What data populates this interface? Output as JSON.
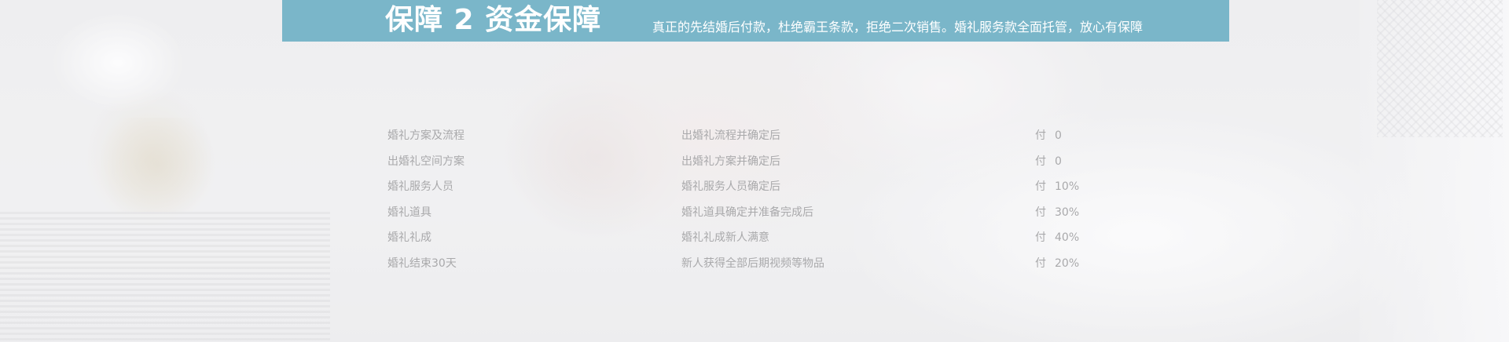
{
  "banner": {
    "title": "保障 2 资金保障",
    "description": "真正的先结婚后付款，杜绝霸王条款，拒绝二次销售。婚礼服务款全面托管，放心有保障",
    "color": "#7ab6c9"
  },
  "table": {
    "rows": [
      {
        "item": "婚礼方案及流程",
        "condition": "出婚礼流程并确定后",
        "pay_label": "付",
        "amount": "0"
      },
      {
        "item": "出婚礼空间方案",
        "condition": "出婚礼方案并确定后",
        "pay_label": "付",
        "amount": "0"
      },
      {
        "item": "婚礼服务人员",
        "condition": "婚礼服务人员确定后",
        "pay_label": "付",
        "amount": "10%"
      },
      {
        "item": "婚礼道具",
        "condition": "婚礼道具确定并准备完成后",
        "pay_label": "付",
        "amount": "30%"
      },
      {
        "item": "婚礼礼成",
        "condition": "婚礼礼成新人满意",
        "pay_label": "付",
        "amount": "40%"
      },
      {
        "item": "婚礼结束30天",
        "condition": "新人获得全部后期视频等物品",
        "pay_label": "付",
        "amount": "20%"
      }
    ]
  }
}
